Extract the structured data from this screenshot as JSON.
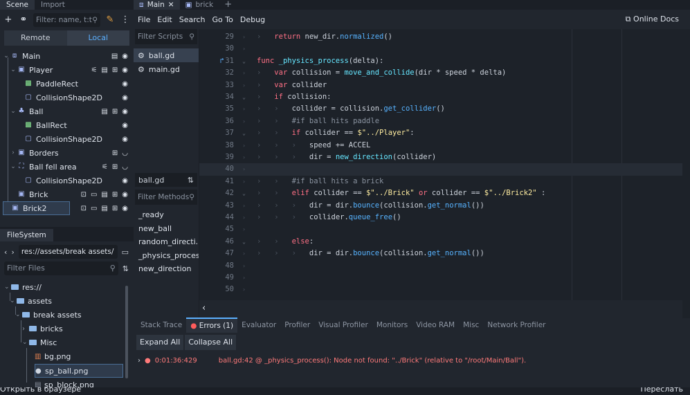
{
  "scene_dock": {
    "tabs": [
      "Scene",
      "Import"
    ],
    "filter_placeholder": "Filter: name, t:t",
    "remote_label": "Remote",
    "local_label": "Local",
    "nodes": [
      {
        "label": "Main",
        "depth": 0,
        "icon": "node2d-icon"
      },
      {
        "label": "Player",
        "depth": 1,
        "icon": "kinematic-body-icon"
      },
      {
        "label": "PaddleRect",
        "depth": 2,
        "icon": "color-rect-icon"
      },
      {
        "label": "CollisionShape2D",
        "depth": 2,
        "icon": "collision-shape-icon"
      },
      {
        "label": "Ball",
        "depth": 1,
        "icon": "physics-body-icon"
      },
      {
        "label": "BallRect",
        "depth": 2,
        "icon": "color-rect-icon"
      },
      {
        "label": "CollisionShape2D",
        "depth": 2,
        "icon": "collision-shape-icon"
      },
      {
        "label": "Borders",
        "depth": 1,
        "icon": "static-body-icon"
      },
      {
        "label": "Ball fell area",
        "depth": 1,
        "icon": "area2d-icon"
      },
      {
        "label": "CollisionShape2D",
        "depth": 2,
        "icon": "collision-shape-icon"
      },
      {
        "label": "Brick",
        "depth": 1,
        "icon": "static-body-icon"
      },
      {
        "label": "Brick2",
        "depth": 1,
        "icon": "static-body-icon"
      }
    ]
  },
  "filesystem": {
    "tab": "FileSystem",
    "path": "res://assets/break assets/",
    "filter_placeholder": "Filter Files",
    "items": [
      {
        "label": "res://",
        "type": "folder"
      },
      {
        "label": "assets",
        "type": "folder"
      },
      {
        "label": "break assets",
        "type": "folder"
      },
      {
        "label": "bricks",
        "type": "folder"
      },
      {
        "label": "Misc",
        "type": "folder"
      },
      {
        "label": "bg.png",
        "type": "file"
      },
      {
        "label": "sp_ball.png",
        "type": "file"
      },
      {
        "label": "sp_block.png",
        "type": "file"
      }
    ]
  },
  "editor_tabs": [
    "Main",
    "brick"
  ],
  "menu": [
    "File",
    "Edit",
    "Search",
    "Go To",
    "Debug"
  ],
  "online_docs": "Online Docs",
  "scripts": {
    "filter_placeholder": "Filter Scripts",
    "list": [
      "ball.gd",
      "main.gd"
    ],
    "current": "ball.gd",
    "methods_placeholder": "Filter Methods",
    "methods": [
      "_ready",
      "new_ball",
      "random_directi...",
      "_physics_process",
      "new_direction"
    ]
  },
  "code": {
    "lines": [
      {
        "n": "29",
        "t": "\treturn new_dir.normalized()"
      },
      {
        "n": "30",
        "t": ""
      },
      {
        "n": "31",
        "t": "func _physics_process(delta):"
      },
      {
        "n": "32",
        "t": "\tvar collision = move_and_collide(dir * speed * delta)"
      },
      {
        "n": "33",
        "t": "\tvar collider"
      },
      {
        "n": "34",
        "t": "\tif collision:"
      },
      {
        "n": "35",
        "t": "\t\tcollider = collision.get_collider()"
      },
      {
        "n": "36",
        "t": "\t\t#if ball hits paddle"
      },
      {
        "n": "37",
        "t": "\t\tif collider == $\"../Player\":"
      },
      {
        "n": "38",
        "t": "\t\t\tspeed += ACCEL"
      },
      {
        "n": "39",
        "t": "\t\t\tdir = new_direction(collider)"
      },
      {
        "n": "40",
        "t": ""
      },
      {
        "n": "41",
        "t": "\t\t#if ball hits a brick"
      },
      {
        "n": "42",
        "t": "\t\telif collider == $\"../Brick\" or collider == $\"../Brick2\" :"
      },
      {
        "n": "43",
        "t": "\t\t\tdir = dir.bounce(collision.get_normal())"
      },
      {
        "n": "44",
        "t": "\t\t\tcollider.queue_free()"
      },
      {
        "n": "45",
        "t": ""
      },
      {
        "n": "46",
        "t": "\t\telse:"
      },
      {
        "n": "47",
        "t": "\t\t\tdir = dir.bounce(collision.get_normal())"
      },
      {
        "n": "48",
        "t": ""
      },
      {
        "n": "49",
        "t": ""
      },
      {
        "n": "50",
        "t": ""
      }
    ]
  },
  "bottom_panel": {
    "tabs": [
      "Stack Trace",
      "Errors (1)",
      "Evaluator",
      "Profiler",
      "Visual Profiler",
      "Monitors",
      "Video RAM",
      "Misc",
      "Network Profiler"
    ],
    "expand_all": "Expand All",
    "collapse_all": "Collapse All",
    "error_time": "0:01:36:429",
    "error_message": "ball.gd:42 @ _physics_process(): Node not found: \"../Brick\" (relative to \"/root/Main/Ball\")."
  },
  "overlay": {
    "left": "Открыть в браузере",
    "right": "Переслать"
  }
}
